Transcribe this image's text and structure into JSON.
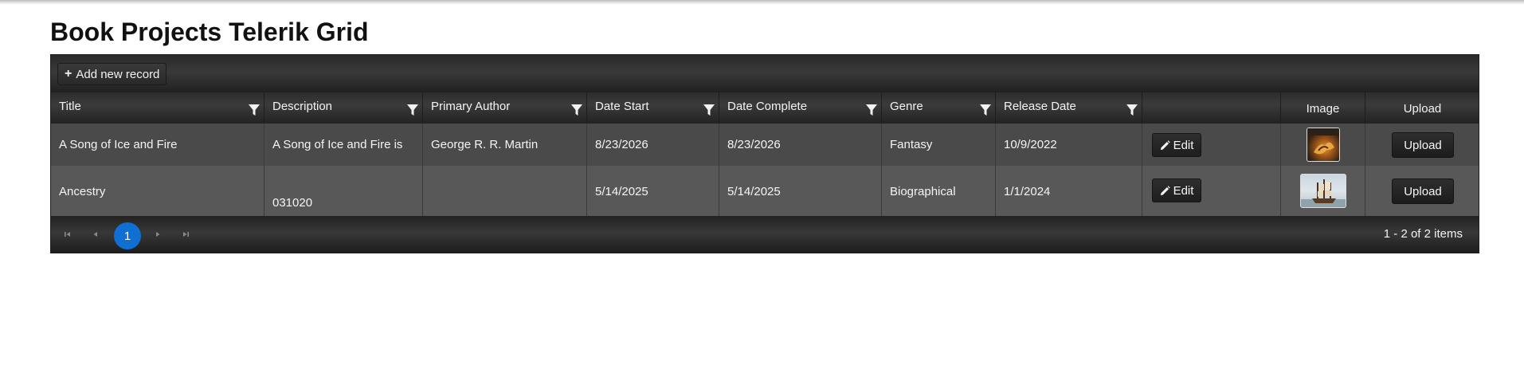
{
  "page": {
    "title": "Book Projects Telerik Grid"
  },
  "toolbar": {
    "add_label": "Add new record"
  },
  "columns": [
    {
      "label": "Title",
      "filterable": true
    },
    {
      "label": "Description",
      "filterable": true
    },
    {
      "label": "Primary Author",
      "filterable": true
    },
    {
      "label": "Date Start",
      "filterable": true
    },
    {
      "label": "Date Complete",
      "filterable": true
    },
    {
      "label": "Genre",
      "filterable": true
    },
    {
      "label": "Release Date",
      "filterable": true
    },
    {
      "label": "",
      "filterable": false
    },
    {
      "label": "Image",
      "filterable": false
    },
    {
      "label": "Upload",
      "filterable": false
    }
  ],
  "rows": [
    {
      "title": "A Song of Ice and Fire",
      "description": "A Song of Ice and Fire is",
      "author": "George R. R. Martin",
      "date_start": "8/23/2026",
      "date_complete": "8/23/2026",
      "genre": "Fantasy",
      "release_date": "10/9/2022",
      "edit_label": "Edit",
      "upload_label": "Upload"
    },
    {
      "title": "Ancestry",
      "description": "031020",
      "author": "",
      "date_start": "5/14/2025",
      "date_complete": "5/14/2025",
      "genre": "Biographical",
      "release_date": "1/1/2024",
      "edit_label": "Edit",
      "upload_label": "Upload"
    }
  ],
  "pager": {
    "current_page": "1",
    "info": "1 - 2 of 2 items"
  },
  "colors": {
    "accent": "#0f6fd3",
    "grid_bg": "#2c2b2b",
    "row_odd": "#4b4a4a",
    "row_even": "#595858"
  }
}
